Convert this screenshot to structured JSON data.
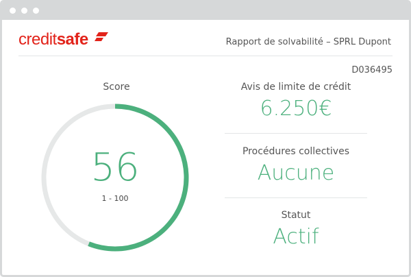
{
  "window": {
    "controls": [
      "dot",
      "dot",
      "dot"
    ]
  },
  "brand": {
    "name_part1": "credit",
    "name_part2": "safe",
    "color": "#e2231a"
  },
  "header": {
    "report_title": "Rapport de solvabilité – SPRL Dupont",
    "reference": "D036495"
  },
  "score": {
    "label": "Score",
    "value": "56",
    "range": "1 - 100",
    "fraction": 0.56,
    "accent_color": "#4cb07d",
    "track_color": "#e6e8e8"
  },
  "details": [
    {
      "label": "Avis de limite de crédit",
      "value": "6.250€"
    },
    {
      "label": "Procédures collectives",
      "value": "Aucune"
    },
    {
      "label": "Statut",
      "value": "Actif"
    }
  ]
}
